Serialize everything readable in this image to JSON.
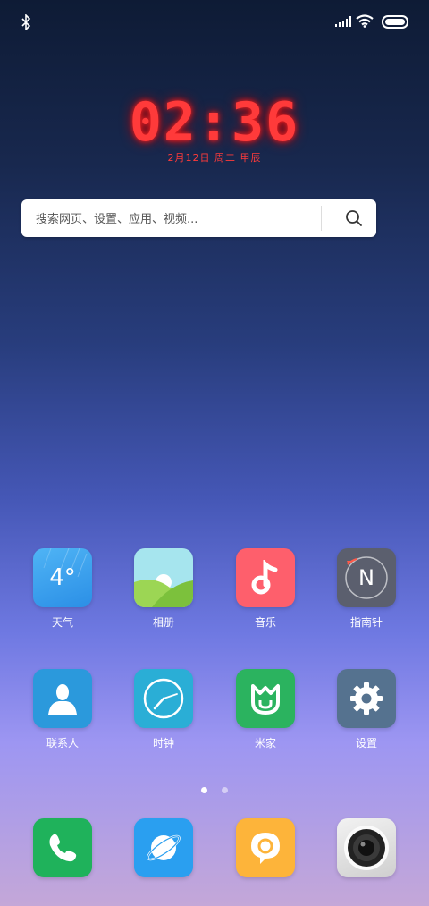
{
  "status_bar": {
    "bluetooth_icon": "bluetooth-icon",
    "signal_icon": "signal-icon",
    "wifi_icon": "wifi-icon",
    "battery_icon": "battery-icon"
  },
  "clock": {
    "time": "02:36",
    "date": "2月12日 周二  甲辰"
  },
  "search": {
    "placeholder": "搜索网页、设置、应用、视频...",
    "icon": "search-icon"
  },
  "apps_row1": [
    {
      "label": "天气",
      "icon": "weather-icon",
      "temp": "4°",
      "color": "#35a0ef"
    },
    {
      "label": "相册",
      "icon": "gallery-icon",
      "color": "#9be1ea"
    },
    {
      "label": "音乐",
      "icon": "music-icon",
      "color": "#fe5f6c"
    },
    {
      "label": "指南针",
      "icon": "compass-icon",
      "compass_letter": "N",
      "color": "#5b5f6e"
    }
  ],
  "apps_row2": [
    {
      "label": "联系人",
      "icon": "contacts-icon",
      "color": "#2b99dc"
    },
    {
      "label": "时钟",
      "icon": "clock-icon",
      "color": "#2aaed6"
    },
    {
      "label": "米家",
      "icon": "mijia-icon",
      "color": "#2bb35f"
    },
    {
      "label": "设置",
      "icon": "settings-icon",
      "color": "#55728f"
    }
  ],
  "dock": [
    {
      "icon": "phone-icon",
      "color": "#1fb25b"
    },
    {
      "icon": "browser-icon",
      "color": "#2a9ff0"
    },
    {
      "icon": "messages-icon",
      "color": "#fdb43a"
    },
    {
      "icon": "camera-icon",
      "color": "#dcdcdc"
    }
  ],
  "page_indicator": {
    "count": 2,
    "active": 0
  }
}
